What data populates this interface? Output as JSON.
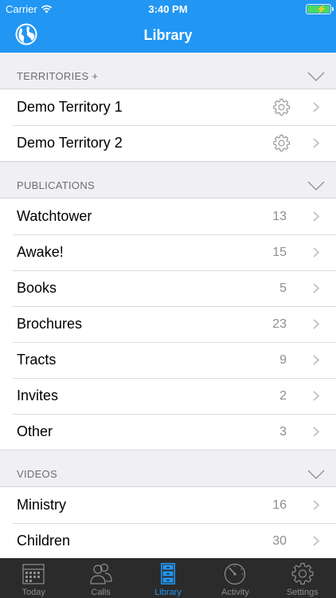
{
  "status_bar": {
    "carrier": "Carrier",
    "time": "3:40 PM",
    "battery_color": "#4cd964"
  },
  "nav": {
    "title": "Library",
    "left_icon": "globe-icon"
  },
  "sections": {
    "territories": {
      "header": "TERRITORIES +",
      "rows": [
        {
          "label": "Demo Territory 1"
        },
        {
          "label": "Demo Territory 2"
        }
      ]
    },
    "publications": {
      "header": "PUBLICATIONS",
      "rows": [
        {
          "label": "Watchtower",
          "count": "13"
        },
        {
          "label": "Awake!",
          "count": "15"
        },
        {
          "label": "Books",
          "count": "5"
        },
        {
          "label": "Brochures",
          "count": "23"
        },
        {
          "label": "Tracts",
          "count": "9"
        },
        {
          "label": "Invites",
          "count": "2"
        },
        {
          "label": "Other",
          "count": "3"
        }
      ]
    },
    "videos": {
      "header": "VIDEOS",
      "rows": [
        {
          "label": "Ministry",
          "count": "16"
        },
        {
          "label": "Children",
          "count": "30"
        }
      ]
    }
  },
  "tabs": [
    {
      "label": "Today",
      "icon": "calendar-icon"
    },
    {
      "label": "Calls",
      "icon": "people-icon"
    },
    {
      "label": "Library",
      "icon": "filing-cabinet-icon",
      "active": true
    },
    {
      "label": "Activity",
      "icon": "gauge-icon"
    },
    {
      "label": "Settings",
      "icon": "gear-icon"
    }
  ],
  "colors": {
    "accent": "#2196f3",
    "tabbar": "#2b2b2b",
    "background": "#efeff4"
  }
}
